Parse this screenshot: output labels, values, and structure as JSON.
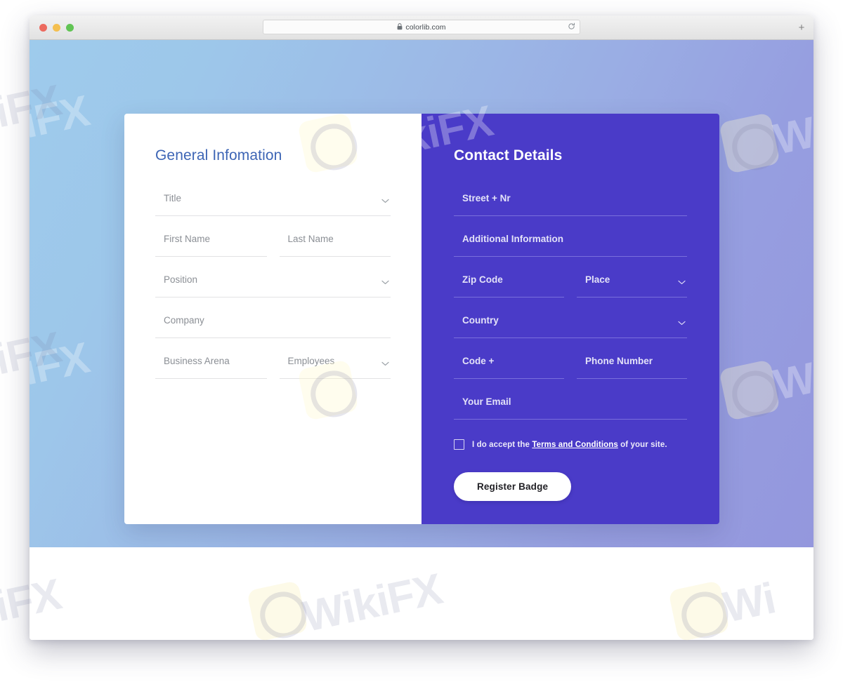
{
  "browser": {
    "url": "colorlib.com",
    "lock_icon": "lock-icon",
    "reload_icon": "reload-icon",
    "newtab_label": "+",
    "traffic_lights": [
      "close",
      "minimize",
      "maximize"
    ]
  },
  "form": {
    "left": {
      "heading": "General Infomation",
      "rows": [
        [
          {
            "label": "Title",
            "type": "select",
            "icon": "chevron-down-icon",
            "width": "full"
          }
        ],
        [
          {
            "label": "First Name",
            "type": "text"
          },
          {
            "label": "Last Name",
            "type": "text"
          }
        ],
        [
          {
            "label": "Position",
            "type": "select",
            "icon": "chevron-down-icon",
            "width": "full"
          }
        ],
        [
          {
            "label": "Company",
            "type": "text",
            "width": "full"
          }
        ],
        [
          {
            "label": "Business Arena",
            "type": "text"
          },
          {
            "label": "Employees",
            "type": "select",
            "icon": "chevron-down-icon"
          }
        ]
      ]
    },
    "right": {
      "heading": "Contact Details",
      "rows": [
        [
          {
            "label": "Street + Nr",
            "type": "text",
            "width": "full"
          }
        ],
        [
          {
            "label": "Additional Information",
            "type": "text",
            "width": "full"
          }
        ],
        [
          {
            "label": "Zip Code",
            "type": "text"
          },
          {
            "label": "Place",
            "type": "select",
            "icon": "chevron-down-icon"
          }
        ],
        [
          {
            "label": "Country",
            "type": "select",
            "icon": "chevron-down-icon",
            "width": "full"
          }
        ],
        [
          {
            "label": "Code +",
            "type": "text"
          },
          {
            "label": "Phone Number",
            "type": "text"
          }
        ],
        [
          {
            "label": "Your Email",
            "type": "text",
            "width": "full"
          }
        ]
      ],
      "accept": {
        "prefix": "I do accept the ",
        "link": "Terms and Conditions",
        "suffix": " of your site.",
        "checked": false
      },
      "submit_label": "Register Badge"
    }
  },
  "watermarks": {
    "text": "WikiFX",
    "short": "kiFX",
    "partial": "Wi"
  },
  "colors": {
    "panel_purple": "#4a3bc8",
    "heading_blue": "#3d65b5",
    "gradient_start": "#9ecbec",
    "gradient_end": "#9497dd",
    "button_bg": "#ffffff"
  }
}
